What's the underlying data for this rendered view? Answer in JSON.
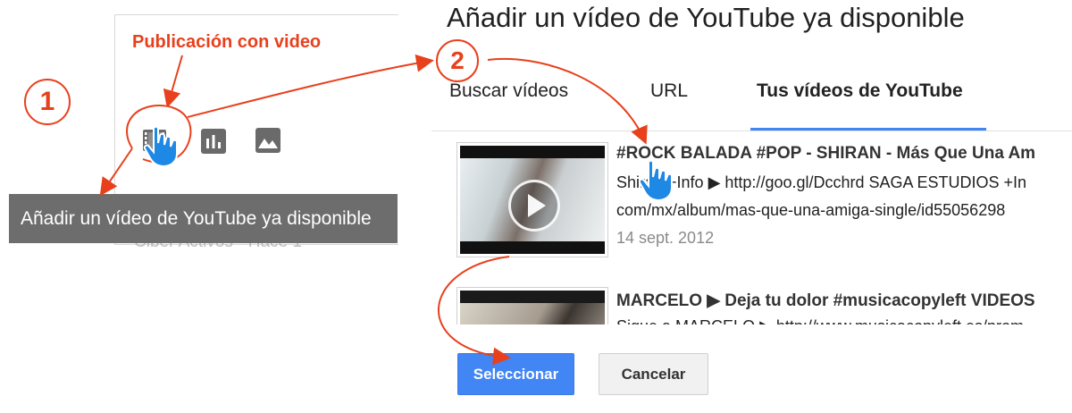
{
  "annotation": {
    "label": "Publicación con video",
    "step1": "1",
    "step2": "2",
    "color": "#e8401c"
  },
  "toolbar": {
    "icons": [
      "film-icon",
      "bar-chart-icon",
      "image-icon"
    ]
  },
  "tooltip": {
    "text": "Añadir un vídeo de YouTube ya disponible"
  },
  "background_row": {
    "text": "Ciber Activos · Hace 1"
  },
  "dialog": {
    "title": "Añadir un vídeo de YouTube ya disponible",
    "tabs": [
      {
        "label": "Buscar vídeos"
      },
      {
        "label": "URL"
      },
      {
        "label": "Tus vídeos de YouTube",
        "active": true
      }
    ],
    "accent": "#4285f4",
    "videos": [
      {
        "title": "#ROCK BALADA #POP - SHIRAN - Más Que Una Am",
        "desc_line1": "Shiran +Info ▶ http://goo.gl/Dcchrd SAGA ESTUDIOS +In",
        "desc_line2": "com/mx/album/mas-que-una-amiga-single/id55056298",
        "date": "14 sept. 2012"
      },
      {
        "title": "MARCELO ▶ Deja tu dolor #musicacopyleft VIDEOS",
        "desc_line1": "Sigue a MARCELO ▶ http://www.musicacopyleft.es/prom"
      }
    ],
    "select_label": "Seleccionar",
    "cancel_label": "Cancelar"
  }
}
